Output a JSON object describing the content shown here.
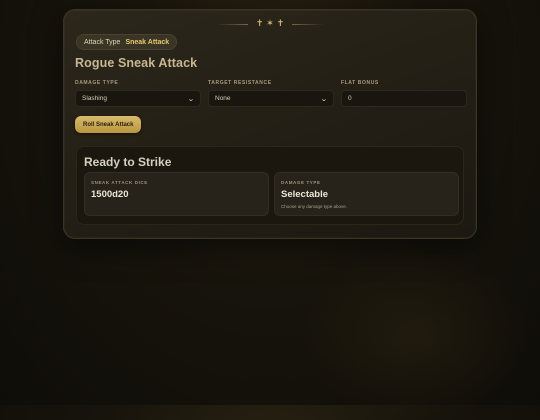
{
  "ornament": {
    "glyphs": "✝ ✶ ✝"
  },
  "badge": {
    "label": "Attack Type",
    "value": "Sneak Attack"
  },
  "title": "Rogue Sneak Attack",
  "fields": {
    "damage_type": {
      "label": "DAMAGE TYPE",
      "value": "Slashing"
    },
    "target_resistance": {
      "label": "TARGET RESISTANCE",
      "value": "None"
    },
    "flat_bonus": {
      "label": "FLAT BONUS",
      "value": "0"
    }
  },
  "roll_button": "Roll Sneak Attack",
  "result": {
    "title": "Ready to Strike",
    "dice": {
      "label": "SNEAK ATTACK DICE",
      "value": "1500d20"
    },
    "damage_type": {
      "label": "DAMAGE TYPE",
      "value": "Selectable",
      "note": "Choose any damage type above."
    }
  },
  "colors": {
    "accent": "#d9bb6c",
    "background": "#17140c",
    "card": "#2c271b"
  },
  "icons": {
    "select_chevron": "chevron-down-icon"
  }
}
